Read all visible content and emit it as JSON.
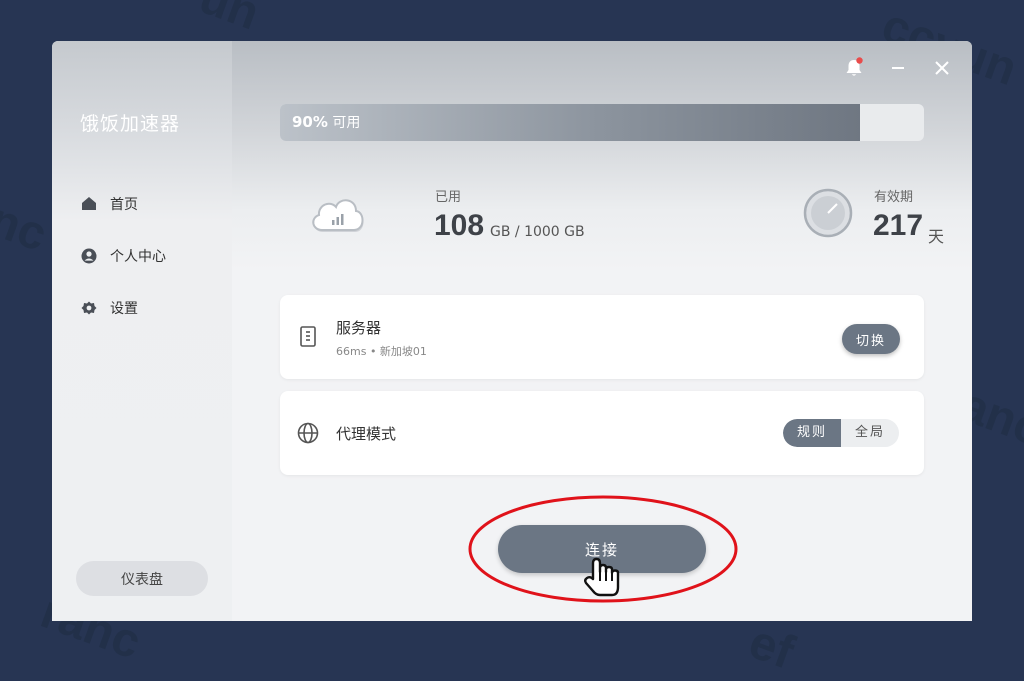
{
  "app": {
    "title": "饿饭加速器"
  },
  "sidebar": {
    "items": [
      {
        "label": "首页",
        "icon": "home-icon"
      },
      {
        "label": "个人中心",
        "icon": "user-icon"
      },
      {
        "label": "设置",
        "icon": "gear-icon"
      }
    ],
    "dashboard_label": "仪表盘"
  },
  "usage": {
    "percent_label": "90%",
    "available_label": "可用",
    "available_fraction": 0.9
  },
  "stats": {
    "used": {
      "label": "已用",
      "value": "108",
      "unit": "GB / 1000 GB",
      "icon": "cloud-chart-icon"
    },
    "validity": {
      "label": "有效期",
      "value": "217",
      "unit": "天",
      "icon": "clock-icon"
    }
  },
  "server": {
    "title": "服务器",
    "detail": "66ms • 新加坡01",
    "switch_label": "切换",
    "icon": "server-icon"
  },
  "proxy": {
    "title": "代理模式",
    "options": [
      "规则",
      "全局"
    ],
    "selected": "规则",
    "icon": "globe-icon"
  },
  "connect": {
    "label": "连接"
  },
  "colors": {
    "accent": "#6b7684",
    "background": "#273553",
    "annotation_ellipse": "#e0121a",
    "notification_dot": "#e94b4b"
  }
}
